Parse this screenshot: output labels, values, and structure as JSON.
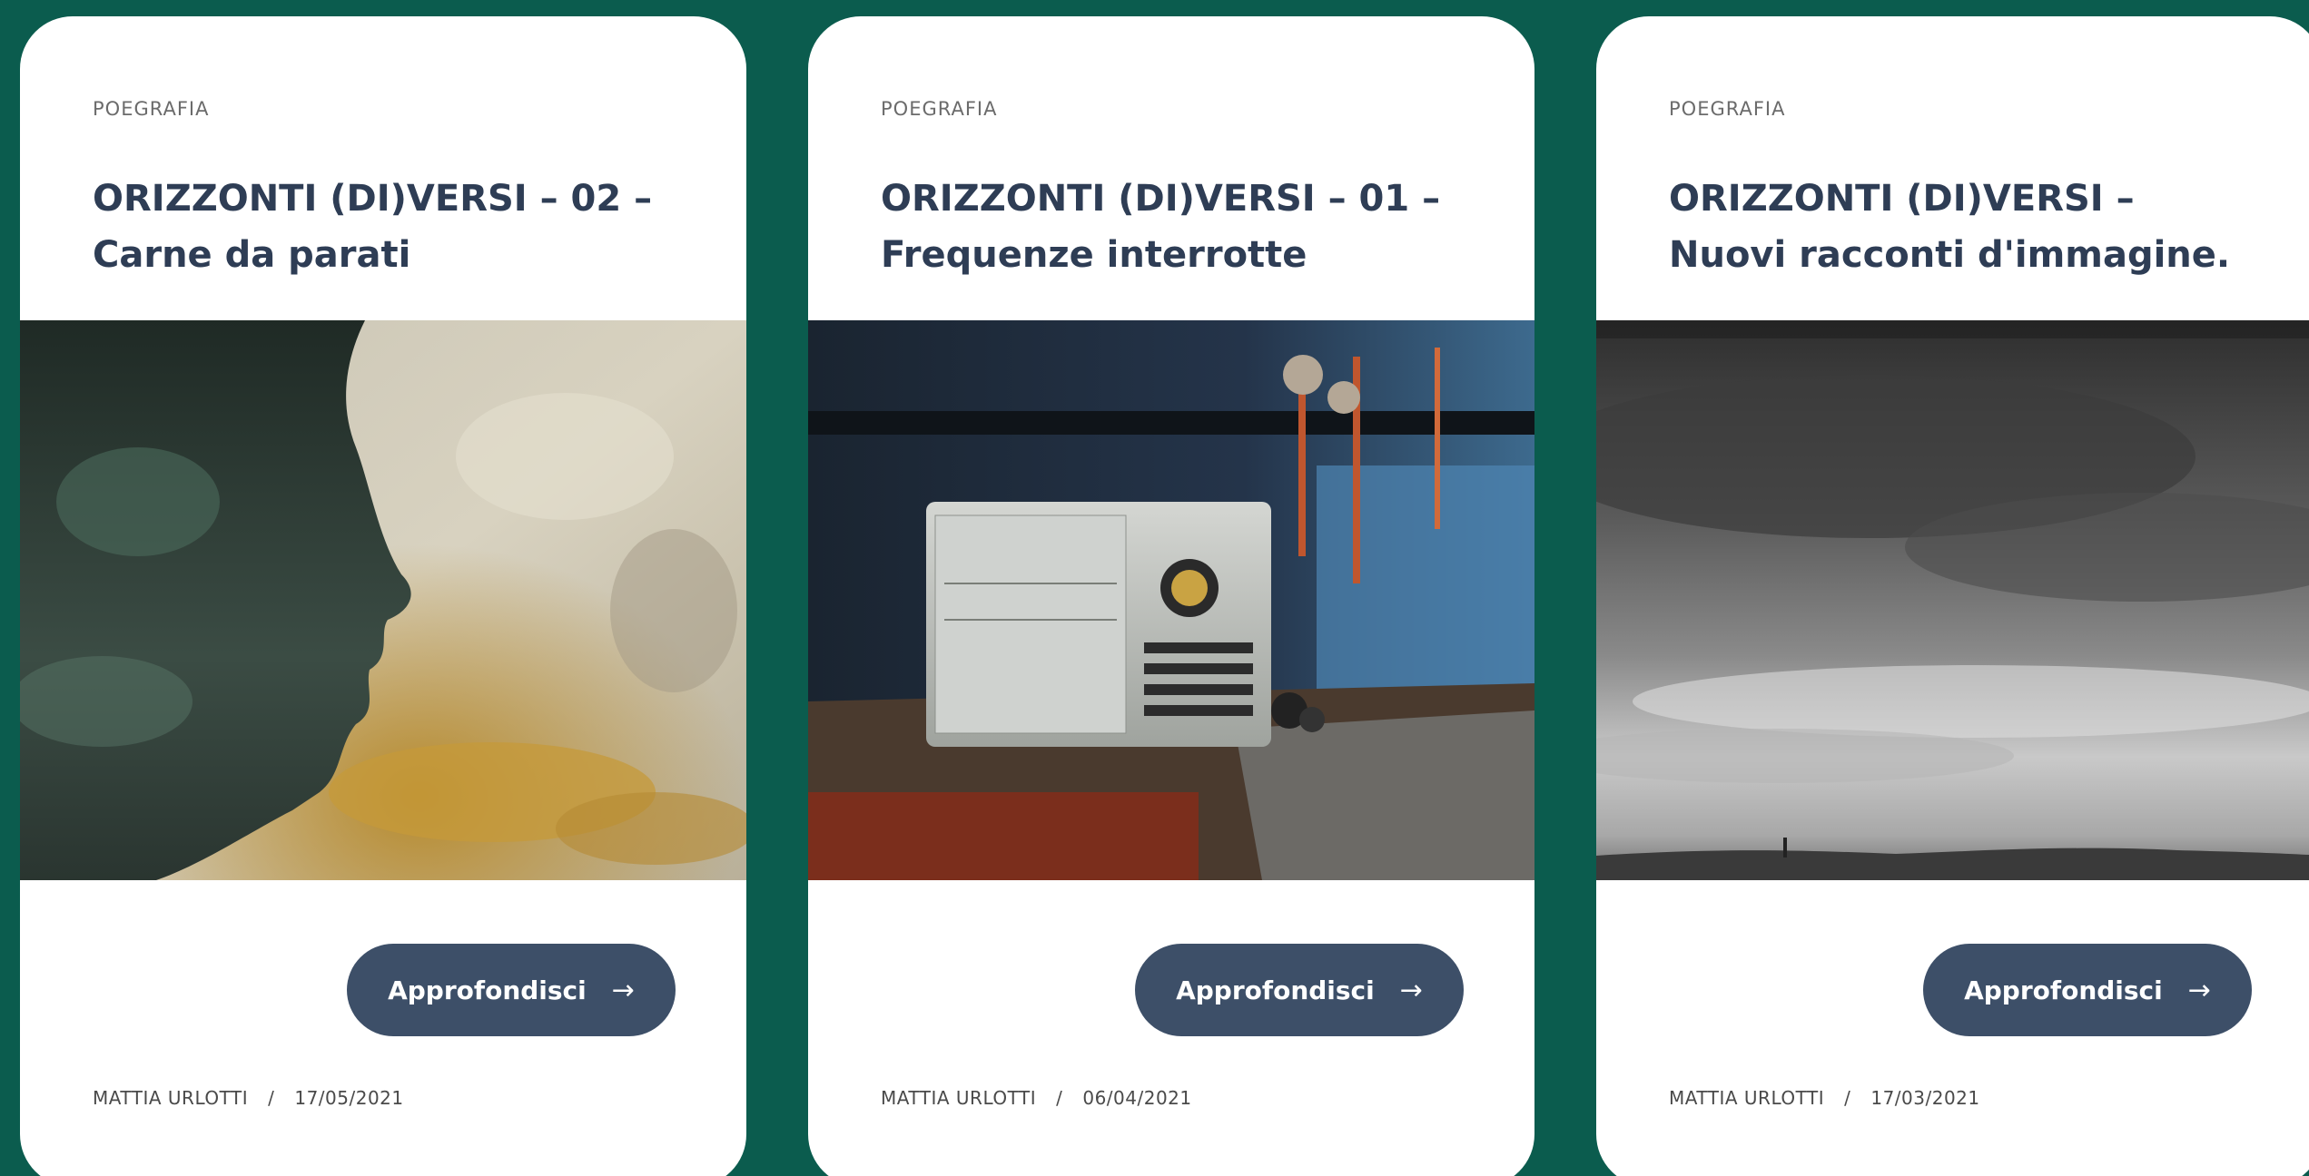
{
  "cards": [
    {
      "category": "POEGRAFIA",
      "title_line1": "ORIZZONTI (DI)VERSI – 02 –",
      "title_line2": "Carne da parati",
      "button_label": "Approfondisci",
      "button_icon": "arrow-right-icon",
      "author": "MATTIA URLOTTI",
      "separator": "/",
      "date": "17/05/2021"
    },
    {
      "category": "POEGRAFIA",
      "title_line1": "ORIZZONTI (DI)VERSI – 01 –",
      "title_line2": "Frequenze interrotte",
      "button_label": "Approfondisci",
      "button_icon": "arrow-right-icon",
      "author": "MATTIA URLOTTI",
      "separator": "/",
      "date": "06/04/2021"
    },
    {
      "category": "POEGRAFIA",
      "title_line1": "ORIZZONTI (DI)VERSI –",
      "title_line2": "Nuovi racconti d'immagine.",
      "button_label": "Approfondisci",
      "button_icon": "arrow-right-icon",
      "author": "MATTIA URLOTTI",
      "separator": "/",
      "date": "17/03/2021"
    }
  ],
  "colors": {
    "background": "#0b5c4e",
    "card": "#ffffff",
    "title": "#2e3d55",
    "button": "#3d4f68",
    "button_text": "#ffffff"
  }
}
